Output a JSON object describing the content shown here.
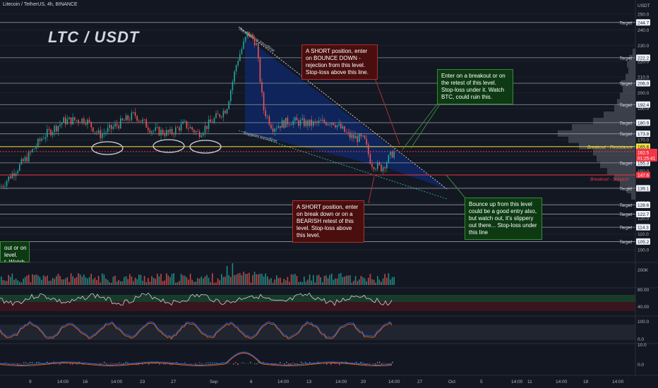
{
  "header": {
    "symbol_line": "Litecoin / TetherUS, 4h, BINANCE",
    "big_title": "LTC / USDT"
  },
  "colors": {
    "background": "#131722",
    "bull": "#26a69a",
    "bear": "#ef5350",
    "target_line": "#d1d4dc",
    "resistance": "#f7e046",
    "support": "#f23645",
    "wedge_fill": "#0d2a6e",
    "volume_profile": "#787b86"
  },
  "price_scale": {
    "currency": "USDT",
    "ticks": [
      "250.0",
      "240.0",
      "230.0",
      "220.0",
      "210.0",
      "200.0",
      "190.0",
      "180.0",
      "170.0",
      "160.0",
      "150.0",
      "140.0",
      "130.0",
      "120.0",
      "110.0",
      "100.0"
    ]
  },
  "levels": {
    "targets": [
      {
        "label": "Target",
        "value": 244.7
      },
      {
        "label": "Target",
        "value": 222.2
      },
      {
        "label": "Target",
        "value": 206.0
      },
      {
        "label": "Target",
        "value": 192.4
      },
      {
        "label": "Target",
        "value": 180.9
      },
      {
        "label": "Target",
        "value": 173.8
      },
      {
        "label": "Target",
        "value": 155.3
      },
      {
        "label": "Target",
        "value": 139.1
      },
      {
        "label": "Target",
        "value": 128.6
      },
      {
        "label": "Target",
        "value": 122.7
      },
      {
        "label": "Target",
        "value": 114.3
      },
      {
        "label": "Target",
        "value": 105.2
      }
    ],
    "resistance": {
      "label": "Breakout - Resistance",
      "value": 165.6
    },
    "support": {
      "label": "Breakout - Support",
      "value": 147.6
    },
    "current": {
      "price": "162.5",
      "countdown": "01:25:41"
    },
    "badges": [
      "244.7",
      "222.2",
      "206.0",
      "192.4",
      "180.9",
      "173.8",
      "165.6",
      "155.3",
      "147.6",
      "139.1",
      "128.6",
      "122.7",
      "114.3",
      "105.2"
    ]
  },
  "trendlines": {
    "resistance_label": "Resistance trendline",
    "support_label": "Support trendline"
  },
  "notes": {
    "short_bounce": "A SHORT position, enter on BOUNCE DOWN - rejection from this level. Stop-loss above this line.",
    "long_breakout": "Enter on a breakout or on the retest of this level. Stop-loss under it. Watch BTC, could ruin this.",
    "short_breakdown": "A SHORT position, enter on break down or on a BEARISH retest of this level. Stop-loss above this level.",
    "bounce_up": "Bounce up from this level could be a good entry also, but watch out, it's slippery out there... Stop-loss under this line",
    "partial_left": "out or on\nlevel.\nt. Watch"
  },
  "volume_pane": {
    "scale_label": "200K"
  },
  "rsi_pane": {
    "ticks": [
      "80.00",
      "40.00"
    ]
  },
  "stoch_pane": {
    "ticks": [
      "100.0",
      "0.0"
    ]
  },
  "macd_pane": {
    "ticks": [
      "10.0",
      "0.0"
    ]
  },
  "time_axis": [
    "9",
    "14:00",
    "16",
    "14:00",
    "23",
    "27",
    "Sep",
    "6",
    "14:00",
    "13",
    "14:00",
    "20",
    "14:00",
    "27",
    "Oct",
    "5",
    "14:00",
    "11",
    "14:00",
    "18",
    "14:00"
  ],
  "chart_data": {
    "type": "candlestick",
    "title": "LTC / USDT",
    "symbol": "Litecoin / TetherUS, 4h, BINANCE",
    "ylim": [
      95,
      252
    ],
    "description_ranges": {
      "aug_range": [
        145,
        185
      ],
      "early_sep_peak": 244.7,
      "sep_range": [
        150,
        190
      ],
      "last_price": 162.5
    },
    "horizontal_levels": [
      244.7,
      222.2,
      206.0,
      192.4,
      180.9,
      173.8,
      165.6,
      155.3,
      147.6,
      139.1,
      128.6,
      122.7,
      114.3,
      105.2
    ],
    "breakout_resistance": 165.6,
    "breakout_support": 147.6
  }
}
